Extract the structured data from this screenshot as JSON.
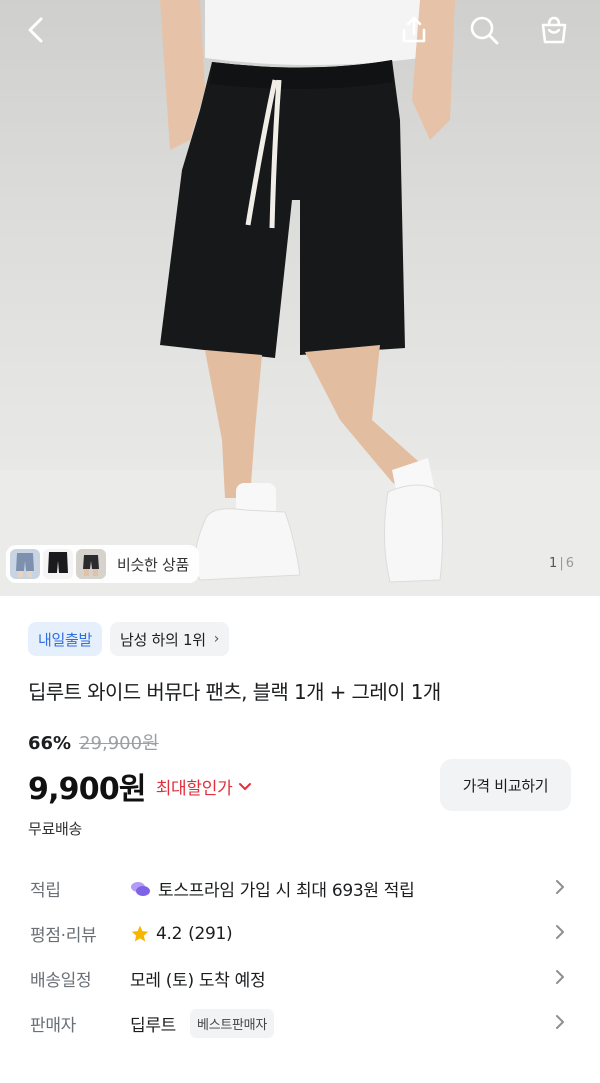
{
  "hero": {
    "similar_label": "비슷한 상품",
    "counter_current": "1",
    "counter_total": "6",
    "counter_sep": "|"
  },
  "icons": {
    "back": "back-icon",
    "share": "share-icon",
    "search": "search-icon",
    "bag": "bag-icon"
  },
  "badges": {
    "shipping": "내일출발",
    "ranking": "남성 하의 1위",
    "ranking_chevron": "›"
  },
  "product": {
    "title": "딥루트 와이드 버뮤다 팬츠, 블랙 1개 + 그레이 1개",
    "discount_percent": "66%",
    "original_price": "29,900원",
    "price": "9,900원",
    "max_discount_label": "최대할인가",
    "compare_button": "가격 비교하기",
    "shipping_fee": "무료배송"
  },
  "info_rows": {
    "points": {
      "label": "적립",
      "value": "토스프라임 가입 시 최대 693원 적립"
    },
    "rating": {
      "label": "평점·리뷰",
      "score": "4.2",
      "count": "(291)"
    },
    "delivery": {
      "label": "배송일정",
      "value": "모레 (토) 도착 예정"
    },
    "seller": {
      "label": "판매자",
      "value": "딥루트",
      "tag": "베스트판매자"
    }
  },
  "colors": {
    "accent_blue": "#2f6fe0",
    "discount_red": "#e1303b",
    "star": "#f7b500"
  }
}
